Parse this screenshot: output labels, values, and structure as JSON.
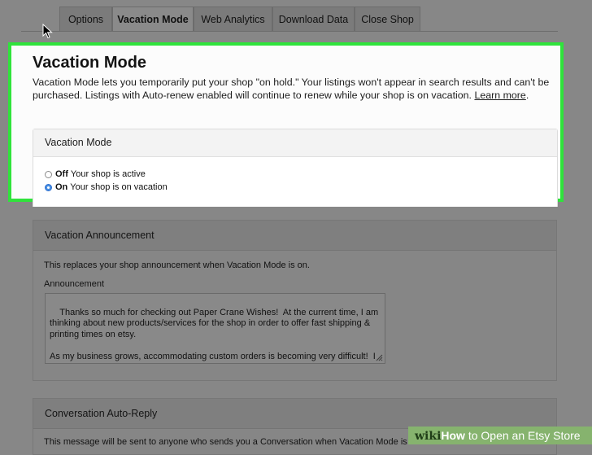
{
  "tabs": [
    {
      "label": "Options",
      "active": false
    },
    {
      "label": "Vacation Mode",
      "active": true
    },
    {
      "label": "Web Analytics",
      "active": false
    },
    {
      "label": "Download Data",
      "active": false
    },
    {
      "label": "Close Shop",
      "active": false
    }
  ],
  "highlight_color": "#2fe33b",
  "vacation": {
    "title": "Vacation Mode",
    "description": "Vacation Mode lets you temporarily put your shop \"on hold.\" Your listings won't appear in search results and can't be purchased. Listings with Auto-renew enabled will continue to renew while your shop is on vacation.",
    "learn_more": "Learn more",
    "card_title": "Vacation Mode",
    "off_label": "Off",
    "off_desc": "Your shop is active",
    "on_label": "On",
    "on_desc": "Your shop is on vacation",
    "selected": "On"
  },
  "announcement": {
    "title": "Vacation Announcement",
    "note": "This replaces your shop announcement when Vacation Mode is on.",
    "field_label": "Announcement",
    "text": "Thanks so much for checking out Paper Crane Wishes!  At the current time, I am thinking about new products/services for the shop in order to offer fast shipping & printing times on etsy.\n\nAs my business grows, accommodating custom orders is becoming very difficult!  I will be creating more items in the future, just not with customization.  So please"
  },
  "autoreply": {
    "title": "Conversation Auto-Reply",
    "note": "This message will be sent to anyone who sends you a Conversation when Vacation Mode is on"
  },
  "watermark": {
    "brand": "wiki",
    "title_bold": "How",
    "title_rest": " to Open an Etsy Store"
  }
}
